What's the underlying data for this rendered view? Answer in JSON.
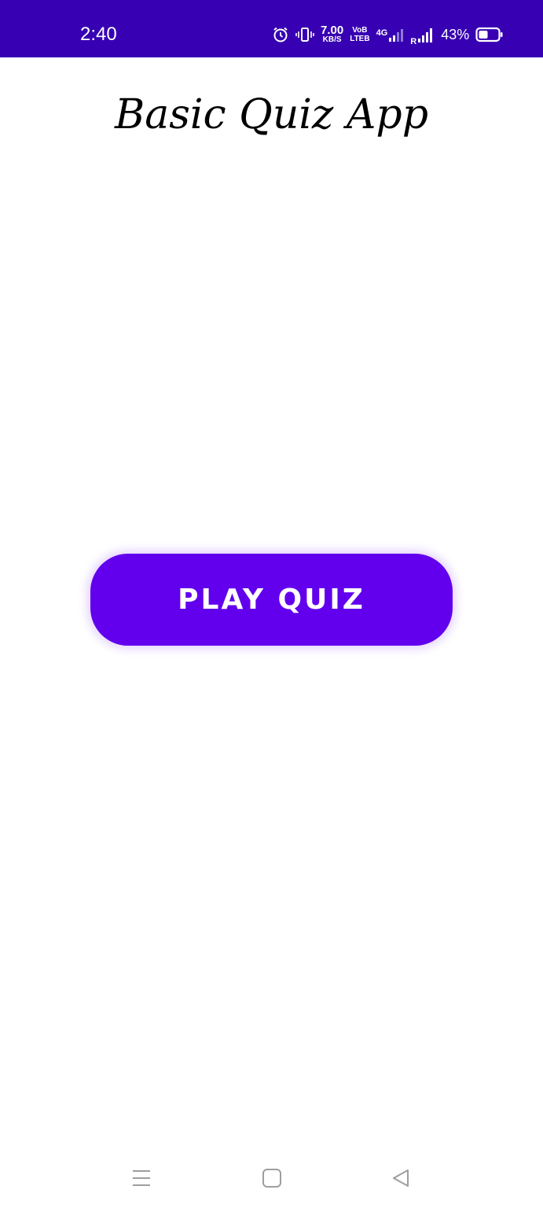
{
  "status_bar": {
    "time": "2:40",
    "net_speed_value": "7.00",
    "net_speed_unit": "KB/S",
    "volte_top": "VoB",
    "volte_bottom": "LTEB",
    "network_type": "4G",
    "roaming": "R",
    "battery_percent": "43%",
    "background_color": "#3700b3",
    "icons": [
      "alarm-icon",
      "vibrate-icon",
      "wifi-signal-icon",
      "cell-signal-icon",
      "battery-icon"
    ]
  },
  "main": {
    "title": "Basic Quiz App",
    "play_button_label": "PLAY QUIZ",
    "accent_color": "#6200ee"
  },
  "nav_bar": {
    "icons": [
      "recent-apps-icon",
      "home-icon",
      "back-icon"
    ]
  }
}
